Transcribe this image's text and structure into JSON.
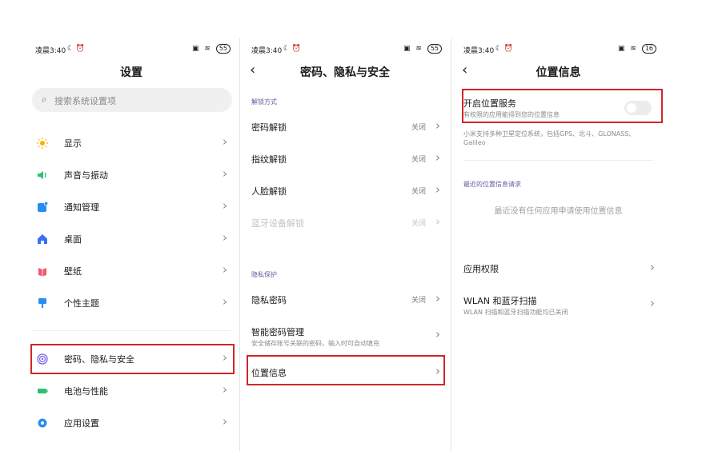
{
  "status_bar": {
    "time": "凌晨3:40",
    "battery": "55",
    "battery_p3": "16"
  },
  "settings": {
    "title": "设置",
    "search_placeholder": "搜索系统设置项",
    "items": [
      {
        "label": "显示",
        "icon": "sun-icon",
        "color": "#f4b400"
      },
      {
        "label": "声音与振动",
        "icon": "speaker-icon",
        "color": "#2fbf71"
      },
      {
        "label": "通知管理",
        "icon": "notification-icon",
        "color": "#2a8cf2"
      },
      {
        "label": "桌面",
        "icon": "home-icon",
        "color": "#3b6ff5"
      },
      {
        "label": "壁纸",
        "icon": "wallpaper-icon",
        "color": "#f05a6e"
      },
      {
        "label": "个性主题",
        "icon": "theme-brush-icon",
        "color": "#2a8cf2"
      }
    ],
    "items2": [
      {
        "label": "密码、隐私与安全",
        "icon": "fingerprint-icon",
        "color": "#7b5ef0"
      },
      {
        "label": "电池与性能",
        "icon": "battery-icon",
        "color": "#2fbf71"
      },
      {
        "label": "应用设置",
        "icon": "gear-icon",
        "color": "#2a8cf2"
      }
    ]
  },
  "security": {
    "title": "密码、隐私与安全",
    "section_unlock": "解锁方式",
    "rows": [
      {
        "label": "密码解锁",
        "value": "关闭"
      },
      {
        "label": "指纹解锁",
        "value": "关闭"
      },
      {
        "label": "人脸解锁",
        "value": "关闭"
      },
      {
        "label": "蓝牙设备解锁",
        "value": "关闭"
      }
    ],
    "section_privacy": "隐私保护",
    "privacy_password": {
      "label": "隐私密码",
      "value": "关闭"
    },
    "smart_password": {
      "label": "智能密码管理",
      "sub": "安全储存账号关联的密码，输入时可自动填充"
    },
    "location": {
      "label": "位置信息"
    }
  },
  "location": {
    "title": "位置信息",
    "toggle_label": "开启位置服务",
    "toggle_sub": "有权限的应用能得到您的位置信息",
    "toggle_on": false,
    "gnss_note": "小米支持多种卫星定位系统，包括GPS、北斗、GLONASS、Galileo",
    "recent_header": "最近的位置信息请求",
    "recent_empty": "最近没有任何应用申请使用位置信息",
    "app_perm": "应用权限",
    "wlan_label": "WLAN 和蓝牙扫描",
    "wlan_sub": "WLAN 扫描和蓝牙扫描功能均已关闭"
  },
  "colors": {
    "highlight": "#d0262b",
    "accent": "#5d5d9f"
  }
}
